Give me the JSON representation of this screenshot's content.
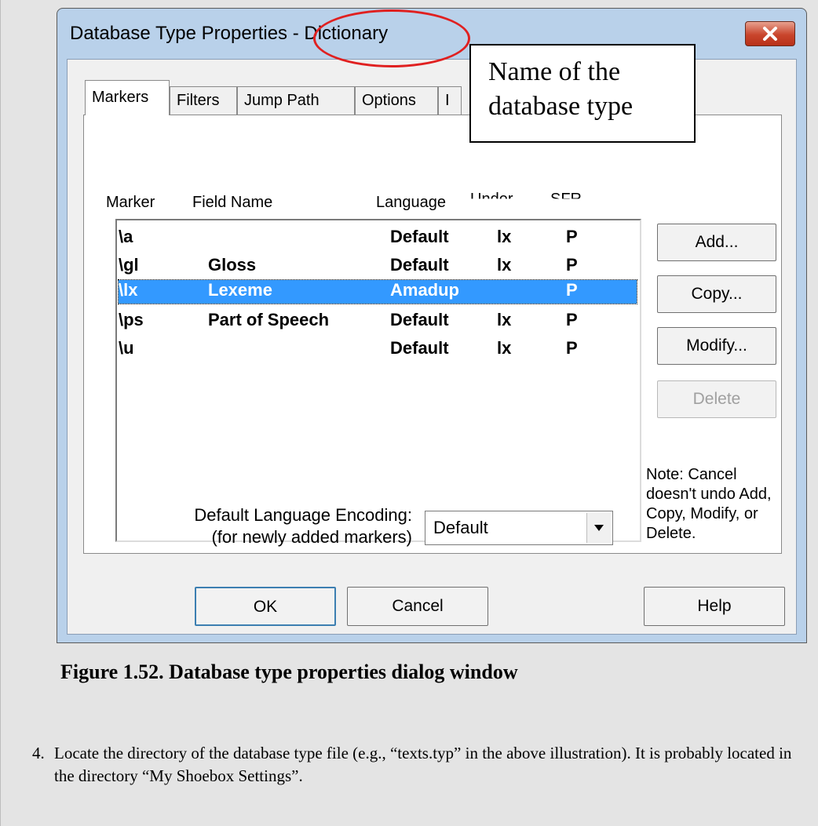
{
  "dialog": {
    "title": "Database Type Properties - Dictionary",
    "tabs": [
      "Markers",
      "Filters",
      "Jump Path",
      "Options",
      "I"
    ],
    "columns": [
      "Marker",
      "Field Name",
      "Language",
      "Under",
      "SFR"
    ],
    "rows": [
      {
        "marker": "\\a",
        "field": "",
        "language": "Default",
        "under": "lx",
        "sfr": "P",
        "selected": false
      },
      {
        "marker": "\\gl",
        "field": "Gloss",
        "language": "Default",
        "under": "lx",
        "sfr": "P",
        "selected": false
      },
      {
        "marker": "\\lx",
        "field": "Lexeme",
        "language": "Amadup",
        "under": "",
        "sfr": "P",
        "selected": true
      },
      {
        "marker": "\\ps",
        "field": "Part of Speech",
        "language": "Default",
        "under": "lx",
        "sfr": "P",
        "selected": false
      },
      {
        "marker": "\\u",
        "field": "",
        "language": "Default",
        "under": "lx",
        "sfr": "P",
        "selected": false
      }
    ],
    "side_buttons": {
      "add": "Add...",
      "copy": "Copy...",
      "modify": "Modify...",
      "delete": "Delete"
    },
    "note": "Note: Cancel doesn't undo Add, Copy, Modify, or Delete.",
    "encoding_label_1": "Default Language Encoding:",
    "encoding_label_2": "(for newly added markers)",
    "encoding_value": "Default",
    "footer_buttons": {
      "ok": "OK",
      "cancel": "Cancel",
      "help": "Help"
    }
  },
  "callout": {
    "line1": "Name of the",
    "line2": "database type"
  },
  "caption": "Figure 1.52. Database type properties dialog window",
  "step": {
    "number": "4.",
    "text": "Locate the directory of the database type file (e.g., “texts.typ” in the above illustration). It is probably located in the directory “My Shoebox Settings”."
  },
  "colors": {
    "selection": "#3399ff",
    "annotation": "#e02020",
    "dialog_frame": "#b9d1ea"
  }
}
